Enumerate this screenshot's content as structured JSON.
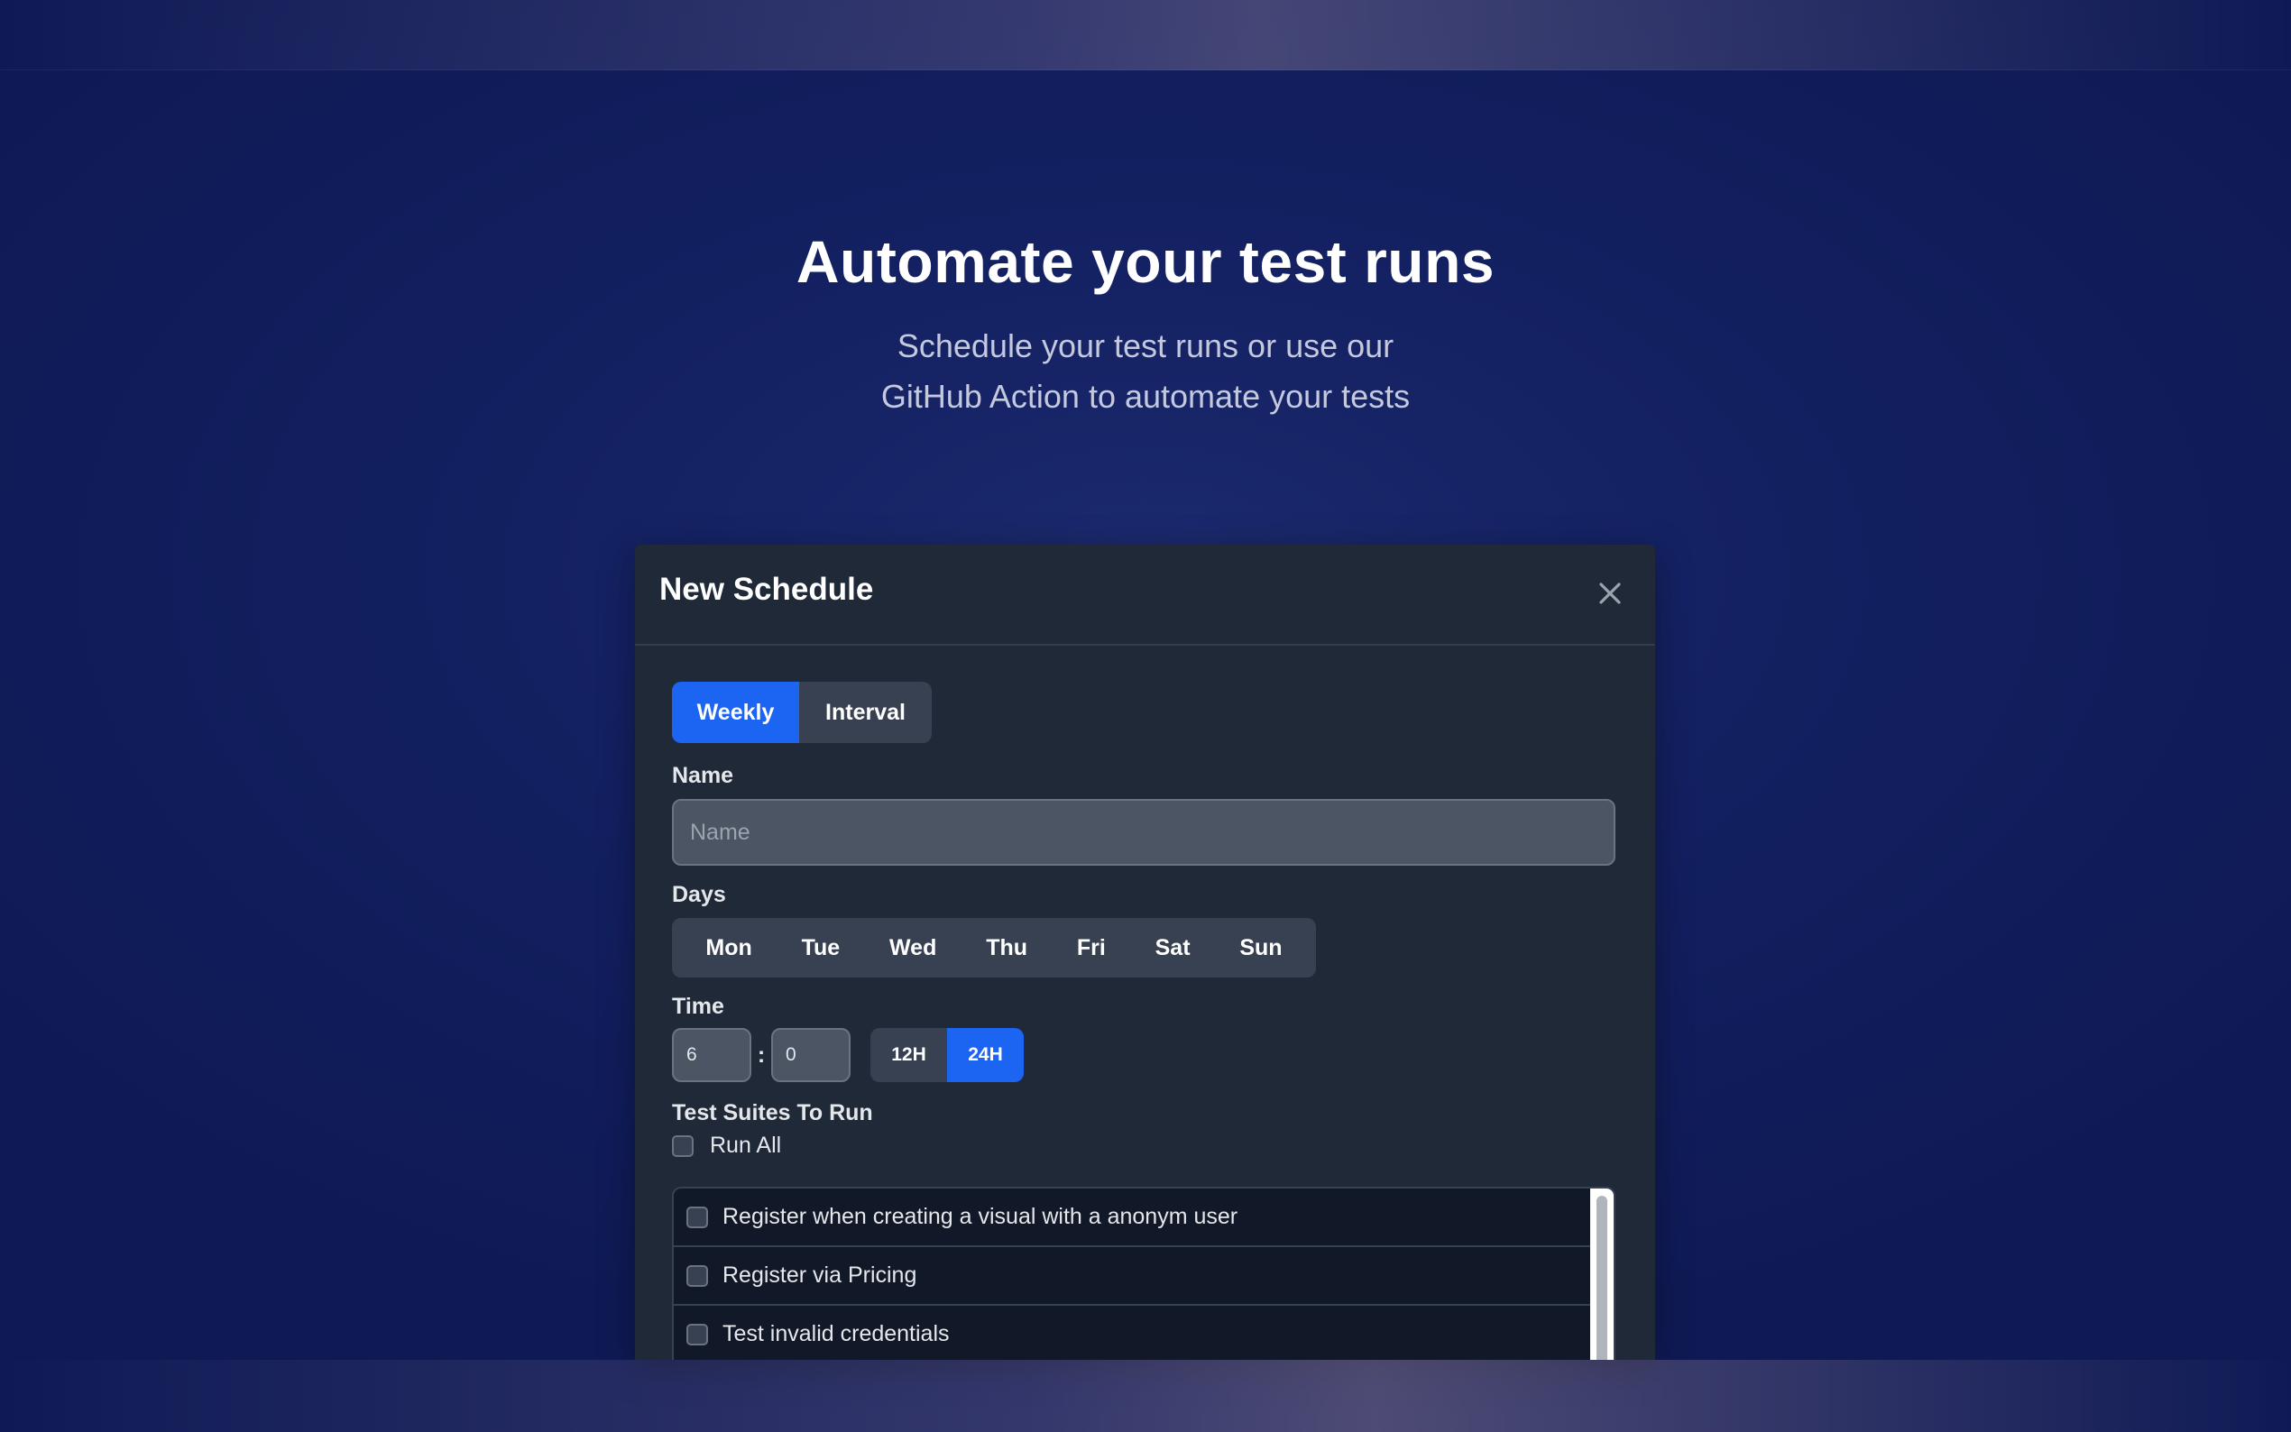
{
  "hero": {
    "title": "Automate your test runs",
    "subtitle_line1": "Schedule your test runs or use our",
    "subtitle_line2": "GitHub Action to automate your tests"
  },
  "modal": {
    "title": "New Schedule",
    "close_icon": "close-icon",
    "mode_tabs": [
      {
        "label": "Weekly",
        "active": true
      },
      {
        "label": "Interval",
        "active": false
      }
    ],
    "name": {
      "label": "Name",
      "placeholder": "Name",
      "value": ""
    },
    "days": {
      "label": "Days",
      "items": [
        "Mon",
        "Tue",
        "Wed",
        "Thu",
        "Fri",
        "Sat",
        "Sun"
      ]
    },
    "time": {
      "label": "Time",
      "hour": "6",
      "minute": "0",
      "separator": ":",
      "formats": [
        {
          "label": "12H",
          "active": false
        },
        {
          "label": "24H",
          "active": true
        }
      ]
    },
    "suites": {
      "label": "Test Suites To Run",
      "run_all_label": "Run All",
      "items": [
        "Register when creating a visual with a anonym user",
        "Register via Pricing",
        "Test invalid credentials"
      ]
    }
  },
  "colors": {
    "background": "#132061",
    "modal": "#202938",
    "accent": "#1c64f2",
    "control": "#374151"
  }
}
